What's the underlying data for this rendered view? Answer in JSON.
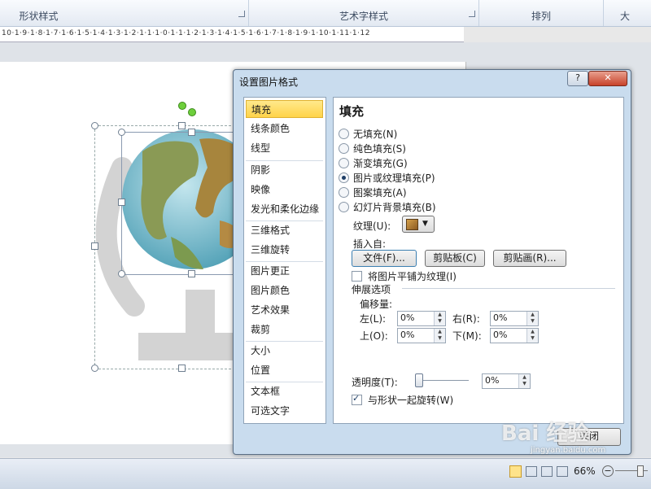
{
  "ribbon": {
    "groups": [
      "形状样式",
      "艺术字样式",
      "排列",
      "大"
    ]
  },
  "ruler": {
    "text": "10·1·9·1·8·1·7·1·6·1·5·1·4·1·3·1·2·1·1·1·0·1·1·1·2·1·3·1·4·1·5·1·6·1·7·1·8·1·9·1·10·1·11·1·12"
  },
  "dialog": {
    "title": "设置图片格式",
    "help": "?",
    "close_icon": "✕",
    "nav": [
      "填充",
      "线条颜色",
      "线型",
      "阴影",
      "映像",
      "发光和柔化边缘",
      "三维格式",
      "三维旋转",
      "图片更正",
      "图片颜色",
      "艺术效果",
      "裁剪",
      "大小",
      "位置",
      "文本框",
      "可选文字"
    ],
    "panel_title": "填充",
    "fill_options": [
      "无填充(N)",
      "纯色填充(S)",
      "渐变填充(G)",
      "图片或纹理填充(P)",
      "图案填充(A)",
      "幻灯片背景填充(B)"
    ],
    "texture_label": "纹理(U):",
    "insert_from": "插入自:",
    "btn_file": "文件(F)...",
    "btn_clipboard": "剪贴板(C)",
    "btn_clipart": "剪贴画(R)...",
    "tile_label": "将图片平铺为纹理(I)",
    "stretch_label": "伸展选项",
    "offset_label": "偏移量:",
    "left": "左(L):",
    "right": "右(R):",
    "top": "上(O):",
    "bottom": "下(M):",
    "left_val": "0%",
    "right_val": "0%",
    "top_val": "0%",
    "bottom_val": "0%",
    "transparency_label": "透明度(T):",
    "transparency_val": "0%",
    "transparency": 0,
    "rotate_label": "与形状一起旋转(W)",
    "close_btn": "关闭"
  },
  "status": {
    "zoom": "66%"
  },
  "watermark": {
    "main": "Bai 经验",
    "sub": "jingyan.baidu.com"
  }
}
